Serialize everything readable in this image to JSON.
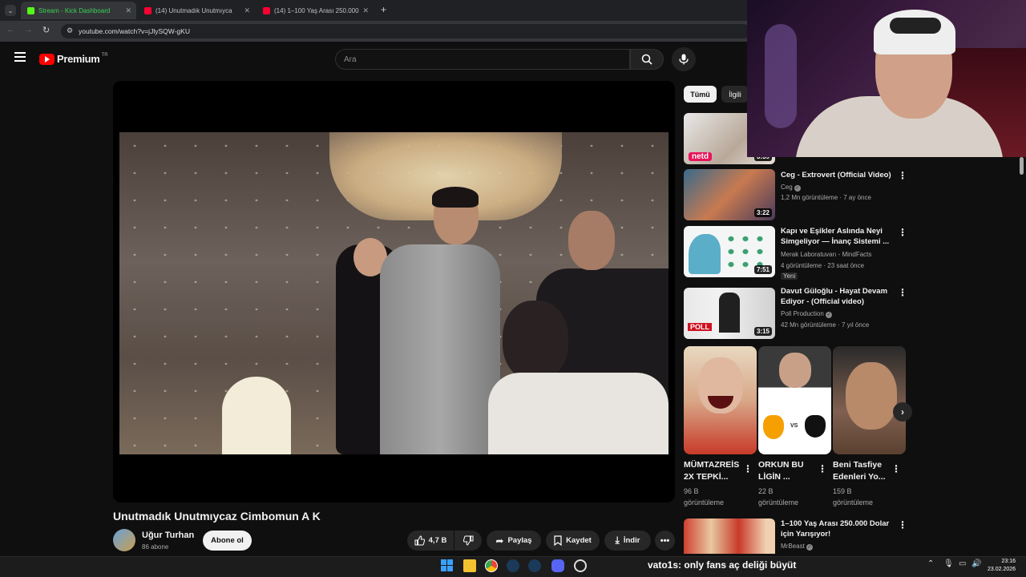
{
  "browser": {
    "tabs": [
      {
        "label": "Stream - Kick Dashboard",
        "active": true,
        "favicon": "kick-icon"
      },
      {
        "label": "(14) Unutmadık Unutmıycaz Ci...",
        "active": false,
        "favicon": "youtube-icon"
      },
      {
        "label": "(14) 1–100 Yaş Arası 250.000 D...",
        "active": false,
        "favicon": "youtube-icon"
      }
    ],
    "url": "youtube.com/watch?v=jJlySQW-gKU"
  },
  "youtube": {
    "logo_text": "Premium",
    "logo_region": "TR",
    "search_placeholder": "Ara"
  },
  "video": {
    "title": "Unutmadık Unutmıycaz Cimbomun A K",
    "channel": "Uğur Turhan",
    "subscribers": "86 abone",
    "subscribe_label": "Abone ol",
    "like_count": "4,7 B",
    "share_label": "Paylaş",
    "save_label": "Kaydet",
    "download_label": "İndir"
  },
  "chips": [
    "Tümü",
    "İlgili"
  ],
  "recommendations": [
    {
      "title": "",
      "channel": "",
      "meta": "",
      "duration": "3:39",
      "thumb_label": "netd"
    },
    {
      "title": "Ceg - Extrovert (Official Video)",
      "channel": "Ceg",
      "meta": "1,2 Mn görüntüleme · 7 ay önce",
      "duration": "3:22",
      "verified": true
    },
    {
      "title": "Kapı ve Eşikler Aslında Neyi Simgeliyor — İnanç Sistemi ...",
      "channel": "Merak Laboratuvarı - MindFacts",
      "meta": "4 görüntüleme · 23 saat önce",
      "badge": "Yeni",
      "duration": "7:51"
    },
    {
      "title": "Davut Güloğlu - Hayat Devam Ediyor - (Official video)",
      "channel": "Poll Production",
      "meta": "42 Mn görüntüleme · 7 yıl önce",
      "duration": "3:15",
      "verified": true,
      "thumb_label": "POLL"
    },
    {
      "title": "1–100 Yaş Arası 250.000 Dolar için Yarışıyor!",
      "channel": "MrBeast",
      "verified": true
    }
  ],
  "shorts": [
    {
      "title": "MÜMTAZREİS 2X TEPKİ...",
      "views": "96 B",
      "views_label": "görüntüleme"
    },
    {
      "title": "ORKUN BU LİGİN ...",
      "views": "22 B",
      "views_label": "görüntüleme",
      "vs_label": "VS"
    },
    {
      "title": "Beni Tasfiye Edenleri Yo...",
      "views": "159 B",
      "views_label": "görüntüleme"
    }
  ],
  "chat_overlay": {
    "user": "vato1s",
    "message": ": only fans aç deliği büyüt"
  },
  "clock": {
    "time": "23:16",
    "date": "23.02.2026"
  },
  "colors": {
    "youtube_red": "#ff0000",
    "kick_green": "#53fc18",
    "bg": "#0f0f0f"
  }
}
